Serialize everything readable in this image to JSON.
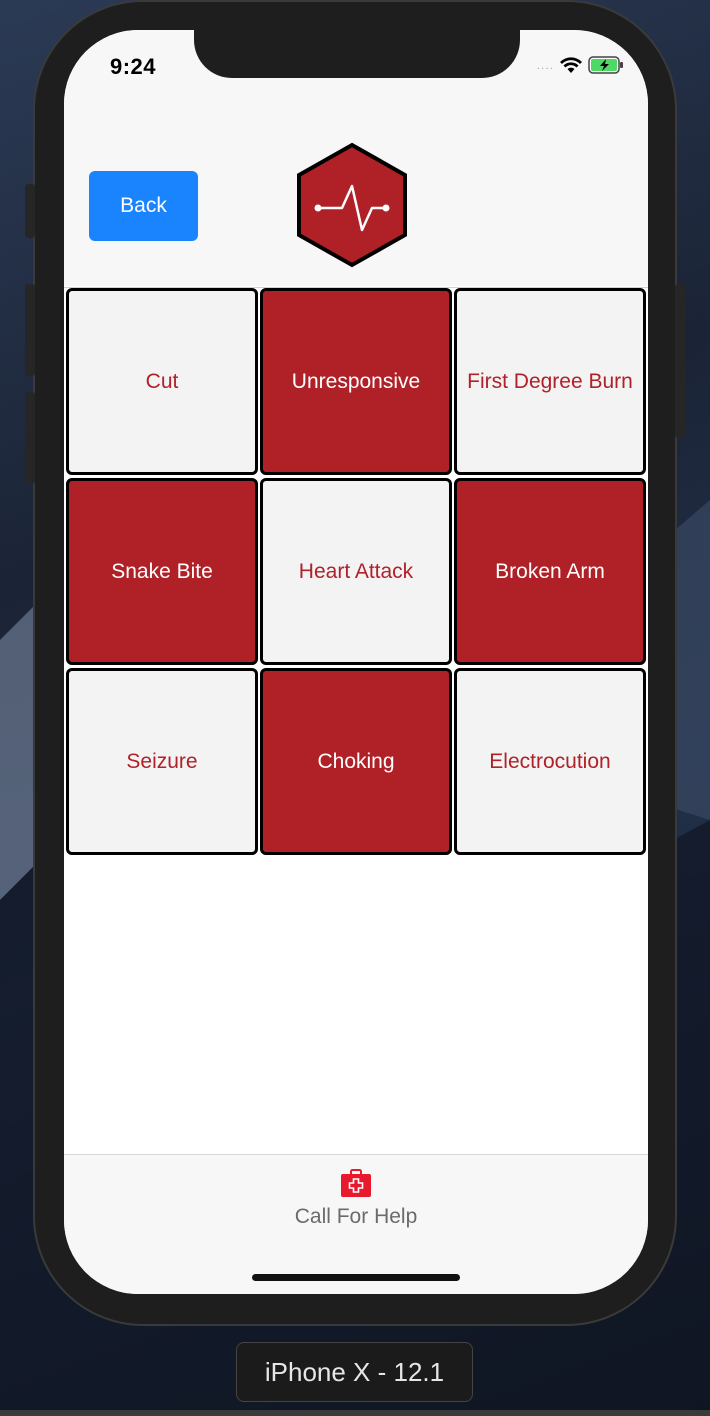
{
  "status_bar": {
    "time": "9:24",
    "signal": "....",
    "battery_icon": "battery-charging-icon",
    "wifi_icon": "wifi-icon"
  },
  "header": {
    "back_label": "Back",
    "logo_icon": "heartbeat-hexagon-logo"
  },
  "grid": {
    "cells": [
      {
        "label": "Cut",
        "style": "light"
      },
      {
        "label": "Unresponsive",
        "style": "dark"
      },
      {
        "label": "First Degree Burn",
        "style": "light"
      },
      {
        "label": "Snake Bite",
        "style": "dark"
      },
      {
        "label": "Heart Attack",
        "style": "light"
      },
      {
        "label": "Broken Arm",
        "style": "dark"
      },
      {
        "label": "Seizure",
        "style": "light"
      },
      {
        "label": "Choking",
        "style": "dark"
      },
      {
        "label": "Electrocution",
        "style": "light"
      }
    ]
  },
  "tabbar": {
    "label": "Call For Help",
    "icon": "first-aid-kit-icon"
  },
  "device": {
    "label": "iPhone X - 12.1"
  },
  "colors": {
    "accent_blue": "#1a84ff",
    "brand_red": "#af2127",
    "light_cell": "#f3f3f3"
  }
}
